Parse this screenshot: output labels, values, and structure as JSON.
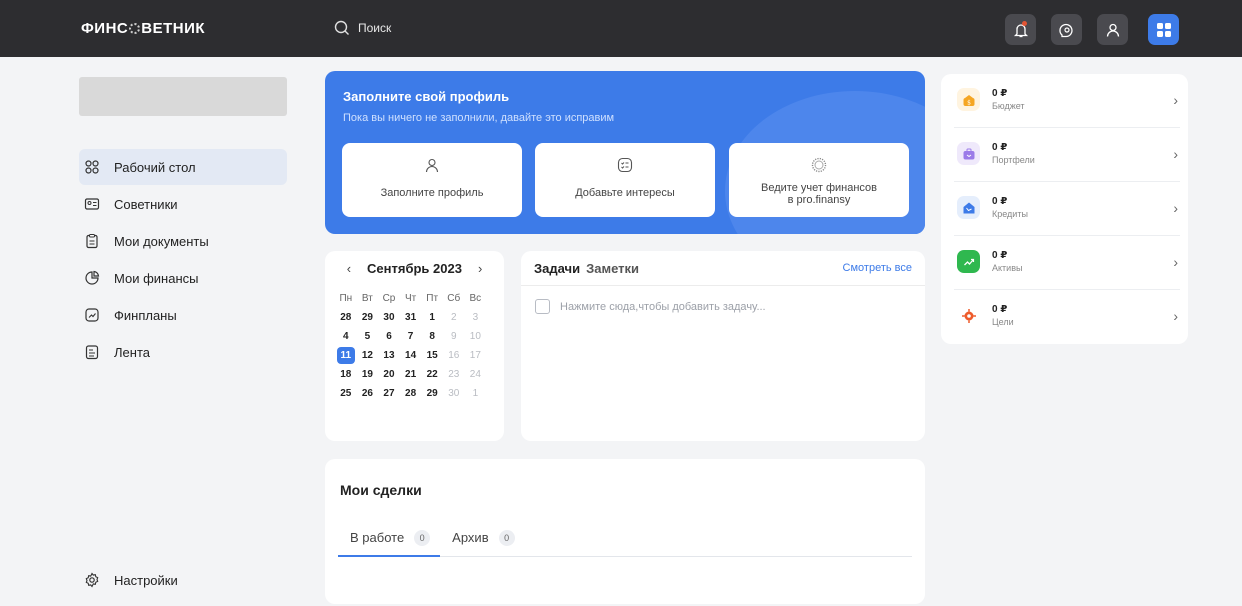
{
  "topbar": {
    "logo_left": "ФИНС",
    "logo_right": "ВЕТНИК",
    "search_label": "Поиск"
  },
  "sidebar": {
    "items": [
      {
        "label": "Рабочий стол",
        "icon": "dashboard-icon"
      },
      {
        "label": "Советники",
        "icon": "id-card-icon"
      },
      {
        "label": "Мои документы",
        "icon": "clipboard-icon"
      },
      {
        "label": "Мои финансы",
        "icon": "pie-chart-icon"
      },
      {
        "label": "Финпланы",
        "icon": "chart-icon"
      },
      {
        "label": "Лента",
        "icon": "feed-icon"
      }
    ],
    "settings_label": "Настройки"
  },
  "profile": {
    "title": "Заполните свой профиль",
    "subtitle": "Пока вы ничего не заполнили, давайте это исправим",
    "cards": [
      {
        "label": "Заполните профиль"
      },
      {
        "label": "Добавьте интересы"
      },
      {
        "label_line1": "Ведите учет финансов",
        "label_line2": "в pro.finansy"
      }
    ]
  },
  "calendar": {
    "month": "Сентябрь 2023",
    "weekdays": [
      "Пн",
      "Вт",
      "Ср",
      "Чт",
      "Пт",
      "Сб",
      "Вс"
    ],
    "weeks": [
      [
        "28",
        "29",
        "30",
        "31",
        "1",
        "2",
        "3"
      ],
      [
        "4",
        "5",
        "6",
        "7",
        "8",
        "9",
        "10"
      ],
      [
        "11",
        "12",
        "13",
        "14",
        "15",
        "16",
        "17"
      ],
      [
        "18",
        "19",
        "20",
        "21",
        "22",
        "23",
        "24"
      ],
      [
        "25",
        "26",
        "27",
        "28",
        "29",
        "30",
        "1"
      ]
    ],
    "today": "11"
  },
  "tasks": {
    "tab_active": "Задачи",
    "tab_other": "Заметки",
    "see_all": "Смотреть все",
    "add_placeholder": "Нажмите сюда,чтобы добавить задачу..."
  },
  "deals": {
    "title": "Мои сделки",
    "tabs": [
      {
        "label": "В работе",
        "count": "0"
      },
      {
        "label": "Архив",
        "count": "0"
      }
    ]
  },
  "finance_summary": {
    "rows": [
      {
        "amount": "0 ₽",
        "label": "Бюджет",
        "icon": "wallet-icon",
        "color": "#f5a623"
      },
      {
        "amount": "0 ₽",
        "label": "Портфели",
        "icon": "briefcase-icon",
        "color": "#9b7be8"
      },
      {
        "amount": "0 ₽",
        "label": "Кредиты",
        "icon": "credit-icon",
        "color": "#3d7be8"
      },
      {
        "amount": "0 ₽",
        "label": "Активы",
        "icon": "growth-icon",
        "color": "#2fb84f"
      },
      {
        "amount": "0 ₽",
        "label": "Цели",
        "icon": "target-icon",
        "color": "#ee5b2b"
      }
    ]
  },
  "colors": {
    "accent": "#3d7be8",
    "topbar": "#2d2d30"
  }
}
